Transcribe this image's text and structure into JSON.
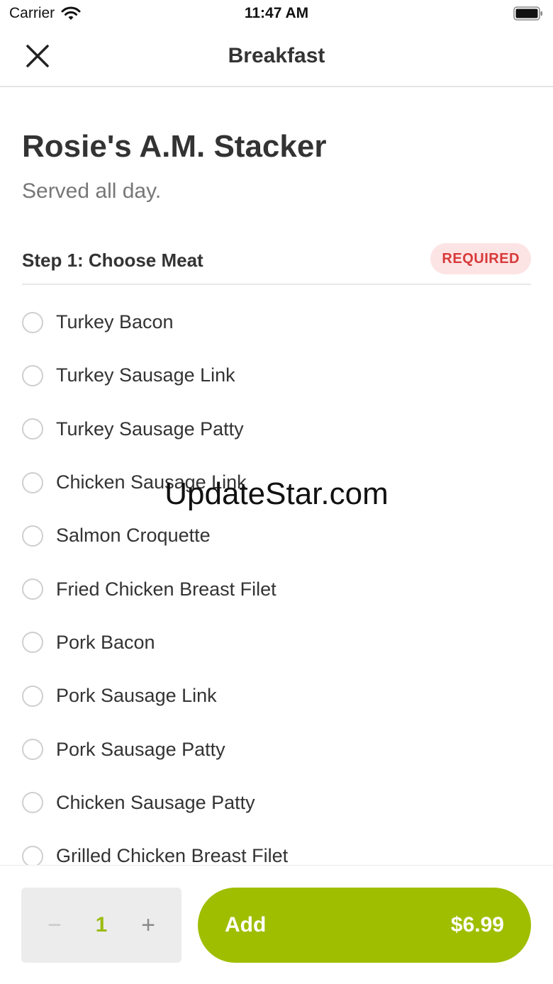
{
  "status_bar": {
    "carrier": "Carrier",
    "time": "11:47 AM",
    "wifi_icon": "wifi-icon",
    "battery_icon": "battery-icon"
  },
  "header": {
    "title": "Breakfast",
    "close_icon": "close-icon"
  },
  "item": {
    "name": "Rosie's A.M. Stacker",
    "subtitle": "Served all day."
  },
  "step": {
    "label": "Step 1: Choose Meat",
    "badge": "REQUIRED",
    "options": [
      {
        "label": "Turkey Bacon"
      },
      {
        "label": "Turkey Sausage Link"
      },
      {
        "label": "Turkey Sausage Patty"
      },
      {
        "label": "Chicken Sausage Link"
      },
      {
        "label": "Salmon Croquette"
      },
      {
        "label": "Fried Chicken Breast Filet"
      },
      {
        "label": "Pork Bacon"
      },
      {
        "label": "Pork Sausage Link"
      },
      {
        "label": "Pork Sausage Patty"
      },
      {
        "label": "Chicken Sausage Patty"
      },
      {
        "label": "Grilled Chicken Breast Filet"
      }
    ]
  },
  "watermark": "UpdateStar.com",
  "footer": {
    "minus": "−",
    "quantity": "1",
    "plus": "+",
    "add_label": "Add",
    "price": "$6.99"
  },
  "colors": {
    "accent": "#a0be00",
    "required_bg": "#fde4e4",
    "required_text": "#d8393a"
  }
}
